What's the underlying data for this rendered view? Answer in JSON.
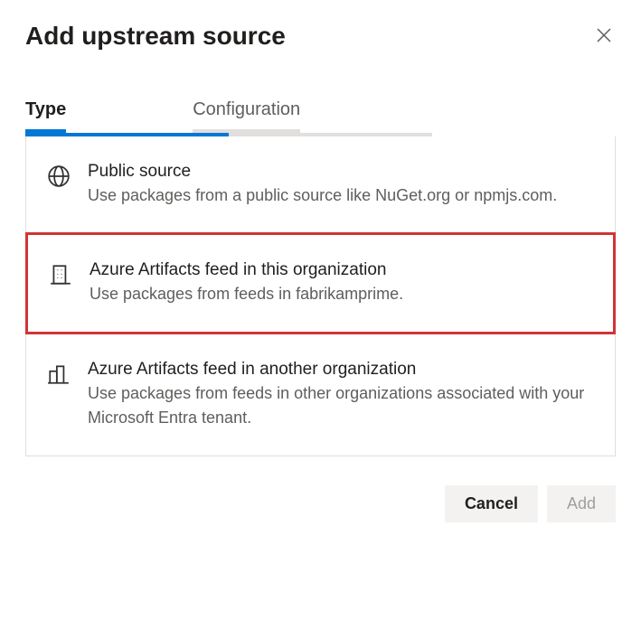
{
  "dialog": {
    "title": "Add upstream source"
  },
  "tabs": {
    "type": "Type",
    "configuration": "Configuration"
  },
  "options": {
    "publicSource": {
      "title": "Public source",
      "desc": "Use packages from a public source like NuGet.org or npmjs.com."
    },
    "thisOrg": {
      "title": "Azure Artifacts feed in this organization",
      "desc": "Use packages from feeds in fabrikamprime."
    },
    "anotherOrg": {
      "title": "Azure Artifacts feed in another organization",
      "desc": "Use packages from feeds in other organizations associated with your Microsoft Entra tenant."
    }
  },
  "footer": {
    "cancel": "Cancel",
    "add": "Add"
  }
}
